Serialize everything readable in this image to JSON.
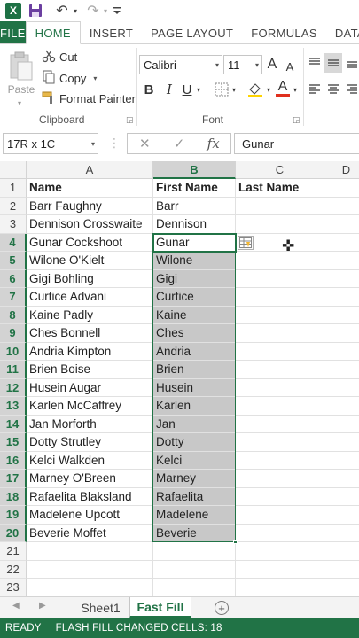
{
  "qat": {
    "app_logo": "X",
    "icons": [
      "excel-logo-icon",
      "save-icon",
      "undo-icon",
      "redo-icon",
      "customize-icon"
    ],
    "undo_glyph": "↶",
    "redo_glyph": "↷",
    "dropdown_glyph": "▾"
  },
  "tabs": [
    "FILE",
    "HOME",
    "INSERT",
    "PAGE LAYOUT",
    "FORMULAS",
    "DATA"
  ],
  "active_tab": "HOME",
  "ribbon": {
    "paste_label": "Paste",
    "cut_label": "Cut",
    "copy_label": "Copy",
    "format_painter_label": "Format Painter",
    "clipboard_group": "Clipboard",
    "font_name": "Calibri",
    "font_size": "11",
    "grow_font": "A",
    "shrink_font": "A",
    "bold": "B",
    "italic": "I",
    "underline": "U",
    "font_color_glyph": "A",
    "fill_color_glyph": "◆",
    "font_group": "Font",
    "accent_red": "#e0301e",
    "accent_yellow": "#ffd400"
  },
  "formula_bar": {
    "name_box": "17R x 1C",
    "cancel_glyph": "✕",
    "enter_glyph": "✓",
    "fx_glyph": "fx",
    "value": "Gunar"
  },
  "grid": {
    "columns": [
      "A",
      "B",
      "C",
      "D"
    ],
    "selected_column": "B",
    "rows": [
      {
        "num": "1",
        "a": "Name",
        "b": "First Name",
        "c": "Last Name"
      },
      {
        "num": "2",
        "a": "Barr Faughny",
        "b": "Barr",
        "c": ""
      },
      {
        "num": "3",
        "a": "Dennison Crosswaite",
        "b": "Dennison",
        "c": ""
      },
      {
        "num": "4",
        "a": "Gunar Cockshoot",
        "b": "Gunar",
        "c": ""
      },
      {
        "num": "5",
        "a": "Wilone O'Kielt",
        "b": "Wilone",
        "c": ""
      },
      {
        "num": "6",
        "a": "Gigi Bohling",
        "b": "Gigi",
        "c": ""
      },
      {
        "num": "7",
        "a": "Curtice Advani",
        "b": "Curtice",
        "c": ""
      },
      {
        "num": "8",
        "a": "Kaine Padly",
        "b": "Kaine",
        "c": ""
      },
      {
        "num": "9",
        "a": "Ches Bonnell",
        "b": "Ches",
        "c": ""
      },
      {
        "num": "10",
        "a": "Andria Kimpton",
        "b": "Andria",
        "c": ""
      },
      {
        "num": "11",
        "a": "Brien Boise",
        "b": "Brien",
        "c": ""
      },
      {
        "num": "12",
        "a": "Husein Augar",
        "b": "Husein",
        "c": ""
      },
      {
        "num": "13",
        "a": "Karlen McCaffrey",
        "b": "Karlen",
        "c": ""
      },
      {
        "num": "14",
        "a": "Jan Morforth",
        "b": "Jan",
        "c": ""
      },
      {
        "num": "15",
        "a": "Dotty Strutley",
        "b": "Dotty",
        "c": ""
      },
      {
        "num": "16",
        "a": "Kelci Walkden",
        "b": "Kelci",
        "c": ""
      },
      {
        "num": "17",
        "a": "Marney O'Breen",
        "b": "Marney",
        "c": ""
      },
      {
        "num": "18",
        "a": "Rafaelita Blaksland",
        "b": "Rafaelita",
        "c": ""
      },
      {
        "num": "19",
        "a": "Madelene Upcott",
        "b": "Madelene",
        "c": ""
      },
      {
        "num": "20",
        "a": "Beverie Moffet",
        "b": "Beverie",
        "c": ""
      },
      {
        "num": "21",
        "a": "",
        "b": "",
        "c": ""
      },
      {
        "num": "22",
        "a": "",
        "b": "",
        "c": ""
      },
      {
        "num": "23",
        "a": "",
        "b": "",
        "c": ""
      }
    ],
    "cursor_glyph": "✜"
  },
  "sheets": {
    "tabs": [
      "Sheet1",
      "Fast Fill"
    ],
    "active": "Fast Fill",
    "add_glyph": "+",
    "nav_left": "◀",
    "nav_right": "▶"
  },
  "status": {
    "mode": "READY",
    "message": "FLASH FILL CHANGED CELLS: 18"
  }
}
